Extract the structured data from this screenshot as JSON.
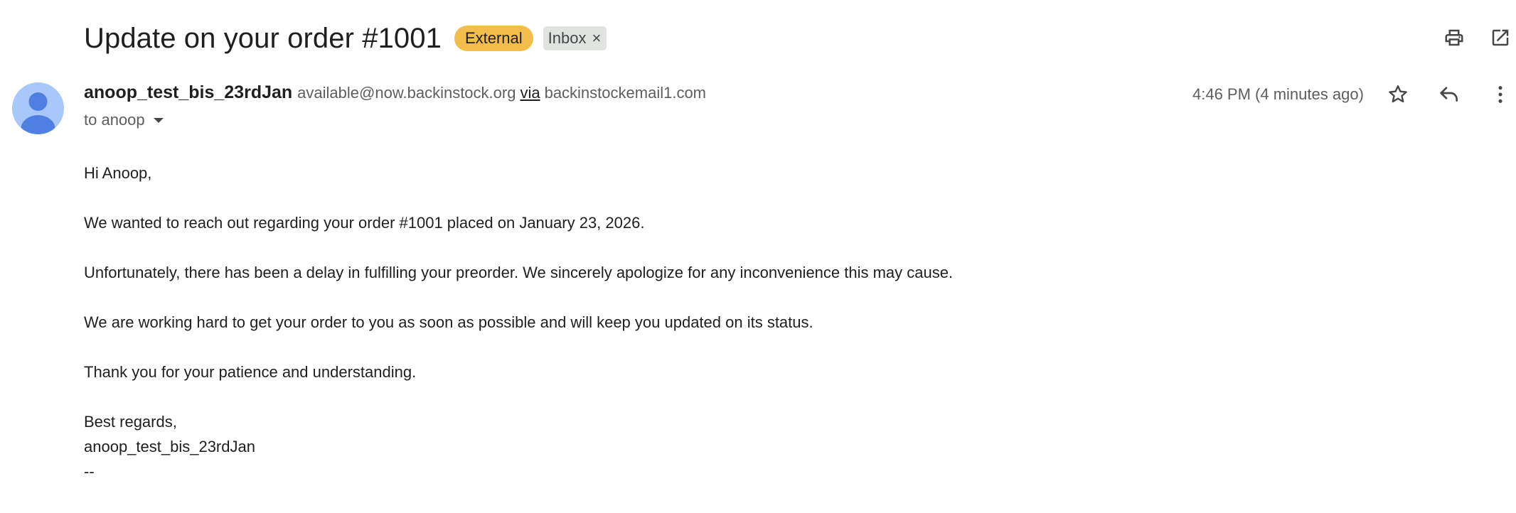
{
  "email": {
    "subject": "Update on your order #1001",
    "labels": {
      "external": "External",
      "inbox": "Inbox",
      "inbox_remove": "×"
    },
    "sender": {
      "name": "anoop_test_bis_23rdJan",
      "email": "available@now.backinstock.org",
      "via_label": "via",
      "via_domain": "backinstockemail1.com"
    },
    "recipient_line": "to anoop",
    "timestamp": "4:46 PM (4 minutes ago)",
    "body": {
      "greeting": "Hi Anoop,",
      "para1": "We wanted to reach out regarding your order #1001 placed on January 23, 2026.",
      "para2": "Unfortunately, there has been a delay in fulfilling your preorder. We sincerely apologize for any inconvenience this may cause.",
      "para3": "We are working hard to get your order to you as soon as possible and will keep you updated on its status.",
      "para4": "Thank you for your patience and understanding.",
      "closing": "Best regards,",
      "signature": "anoop_test_bis_23rdJan",
      "separator": "--"
    }
  },
  "icons": {
    "print": "printer-icon",
    "open_new_window": "open-in-new-icon",
    "star": "star-icon",
    "reply": "reply-icon",
    "more": "more-vert-icon",
    "avatar": "person-avatar-icon",
    "expand_recipients": "caret-down-icon"
  },
  "colors": {
    "external_badge": "#f2bd4a",
    "inbox_badge": "#e1e3e1",
    "avatar_bg": "#a8c7fa",
    "avatar_fg": "#4f7fe0"
  }
}
